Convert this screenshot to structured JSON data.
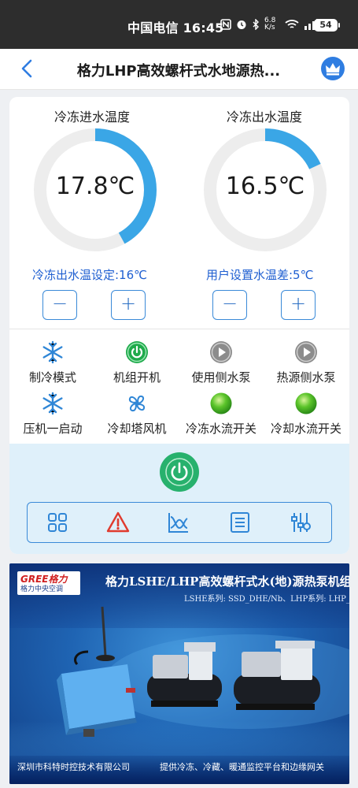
{
  "status_bar": {
    "text": "中国电信 16:45",
    "icons": [
      "nfc-icon",
      "alarm-icon",
      "bluetooth-icon",
      "data-speed-icon",
      "wifi-icon",
      "signal-icon"
    ],
    "speed": "6.8 K/s",
    "battery": "54"
  },
  "header": {
    "title": "格力LHP高效螺杆式水地源热...",
    "accent": "#2f7de1"
  },
  "gauges": [
    {
      "label": "冷冻进水温度",
      "value": "17.8℃",
      "fill": 0.42
    },
    {
      "label": "冷冻出水温度",
      "value": "16.5℃",
      "fill": 0.18
    }
  ],
  "settings": [
    {
      "label": "冷冻出水温设定:16℃",
      "minus": "−",
      "plus": "+"
    },
    {
      "label": "用户设置水温差:5℃",
      "minus": "−",
      "plus": "+"
    }
  ],
  "status_items": [
    {
      "label": "制冷模式",
      "icon": "snowflake-icon"
    },
    {
      "label": "机组开机",
      "icon": "power-on-icon"
    },
    {
      "label": "使用侧水泵",
      "icon": "play-gray-icon"
    },
    {
      "label": "热源侧水泵",
      "icon": "play-gray-icon"
    },
    {
      "label": "压机一启动",
      "icon": "snowflake-icon"
    },
    {
      "label": "冷却塔风机",
      "icon": "fan-icon"
    },
    {
      "label": "冷冻水流开关",
      "icon": "green-dot-icon"
    },
    {
      "label": "冷却水流开关",
      "icon": "green-dot-icon"
    }
  ],
  "toolbar": {
    "icons": [
      "grid-icon",
      "alarm-warning-icon",
      "trend-chart-icon",
      "list-icon",
      "sliders-icon"
    ]
  },
  "colors": {
    "gauge_fill": "#3aa6e6",
    "gauge_track": "#ededed",
    "power_green": "#27b16d",
    "setting_blue": "#1f5fd1"
  },
  "banner": {
    "logo_top": "GREE格力",
    "logo_bottom": "格力中央空调",
    "title": "格力LSHE/LHP高效螺杆式水(地)源热泵机组",
    "subtitle": "LSHE系列: SSD_DHE/Nb、LHP系列: LHP_/Nb",
    "footer_left": "深圳市科特时控技术有限公司",
    "footer_right": "提供冷冻、冷藏、暖通监控平台和边缘网关"
  }
}
